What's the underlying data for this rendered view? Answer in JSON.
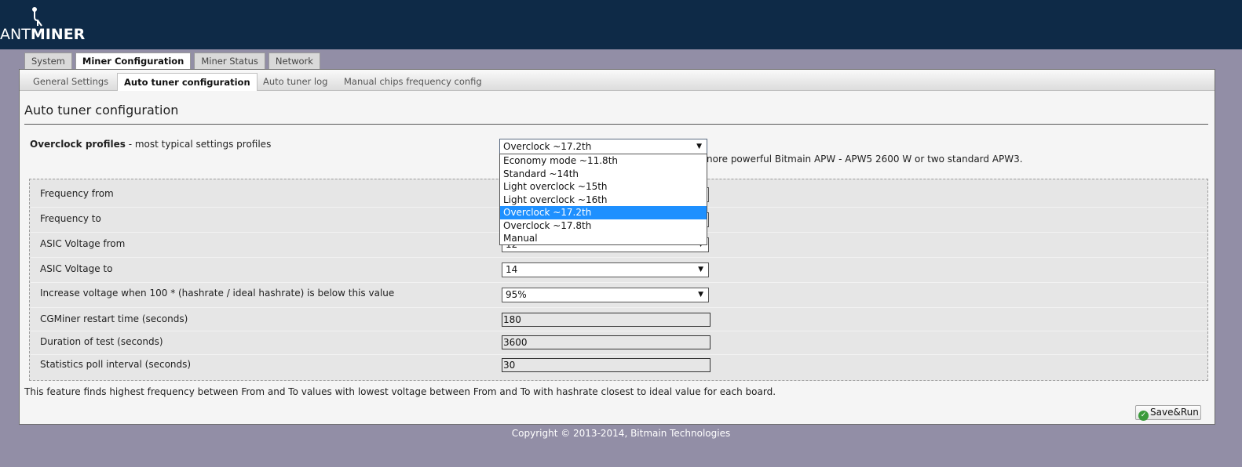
{
  "app": {
    "logo_thin": "ANT",
    "logo_bold": "MINER",
    "logo_icon": "antenna-icon"
  },
  "tabs_top": [
    {
      "label": "System",
      "active": false
    },
    {
      "label": "Miner Configuration",
      "active": true
    },
    {
      "label": "Miner Status",
      "active": false
    },
    {
      "label": "Network",
      "active": false
    }
  ],
  "subtabs": [
    {
      "label": "General Settings",
      "active": false
    },
    {
      "label": "Auto tuner configuration",
      "active": true
    },
    {
      "label": "Auto tuner log",
      "active": false
    },
    {
      "label": "Manual chips frequency config",
      "active": false
    }
  ],
  "page_title": "Auto tuner configuration",
  "profile": {
    "label_bold": "Overclock profiles",
    "label_rest": " - most typical settings profiles",
    "selected": "Overclock ~17.2th",
    "options": [
      "Economy mode ~11.8th",
      "Standard ~14th",
      "Light overclock ~15th",
      "Light overclock ~16th",
      "Overclock ~17.2th",
      "Overclock ~17.8th",
      "Manual"
    ],
    "highlighted": "Overclock ~17.2th",
    "note_visible": "nore powerful Bitmain APW - APW5 2600 W or two standard APW3."
  },
  "settings": {
    "frequency_from": {
      "label": "Frequency from",
      "value": ""
    },
    "frequency_to": {
      "label": "Frequency to",
      "value": ""
    },
    "voltage_from": {
      "label": "ASIC Voltage from",
      "value": "12"
    },
    "voltage_to": {
      "label": "ASIC Voltage to",
      "value": "14"
    },
    "increase_voltage": {
      "label": "Increase voltage when 100 * (hashrate / ideal hashrate) is below this value",
      "value": "95%"
    },
    "restart_time": {
      "label": "CGMiner restart time (seconds)",
      "value": "180"
    },
    "test_duration": {
      "label": "Duration of test (seconds)",
      "value": "3600"
    },
    "poll_interval": {
      "label": "Statistics poll interval (seconds)",
      "value": "30"
    }
  },
  "footnote": "This feature finds highest frequency between From and To values with lowest voltage between From and To with hashrate closest to ideal value for each board.",
  "save_button": "Save&Run",
  "copyright": "Copyright © 2013-2014, Bitmain Technologies",
  "colors": {
    "header_bg": "#0e2a47",
    "page_bg": "#928ea6",
    "highlight": "#1e90ff"
  }
}
